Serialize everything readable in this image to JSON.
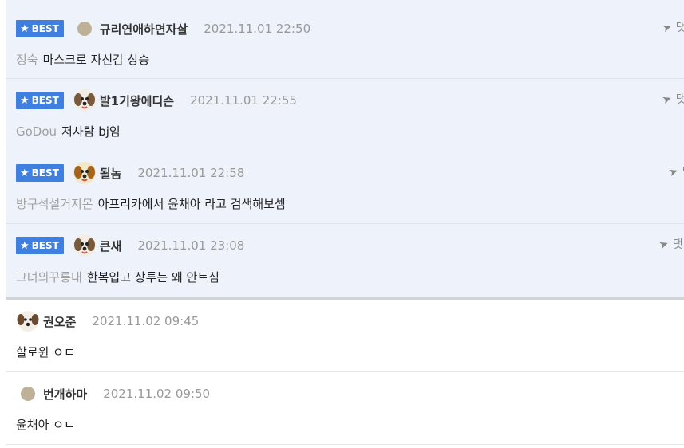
{
  "badge_label": "BEST",
  "reply_label": "댓",
  "best_comments": [
    {
      "nick": "규리연애하면자살",
      "date": "2021.11.01 22:50",
      "to": "정숙",
      "text": "마스크로 자신감 상승",
      "avatar": "dot"
    },
    {
      "nick": "발1기왕에디슨",
      "date": "2021.11.01 22:55",
      "to": "GoDou",
      "text": "저사람 bj임",
      "avatar": "dog"
    },
    {
      "nick": "될놈",
      "date": "2021.11.01 22:58",
      "to": "방구석설거지몬",
      "text": "아프리카에서 윤채아 라고 검색해보셈",
      "avatar": "dog"
    },
    {
      "nick": "큰새",
      "date": "2021.11.01 23:08",
      "to": "그녀의꾸릉내",
      "text": "한복입고 상투는 왜 안트심",
      "avatar": "dog"
    }
  ],
  "comments": [
    {
      "nick": "권오준",
      "date": "2021.11.02 09:45",
      "text": "할로윈 ㅇㄷ",
      "avatar": "dog"
    },
    {
      "nick": "번개하마",
      "date": "2021.11.02 09:50",
      "text": "윤채아 ㅇㄷ",
      "avatar": "dot"
    }
  ],
  "colors": {
    "badge": "#3f7fe0",
    "best_bg": "#eef3fb"
  }
}
